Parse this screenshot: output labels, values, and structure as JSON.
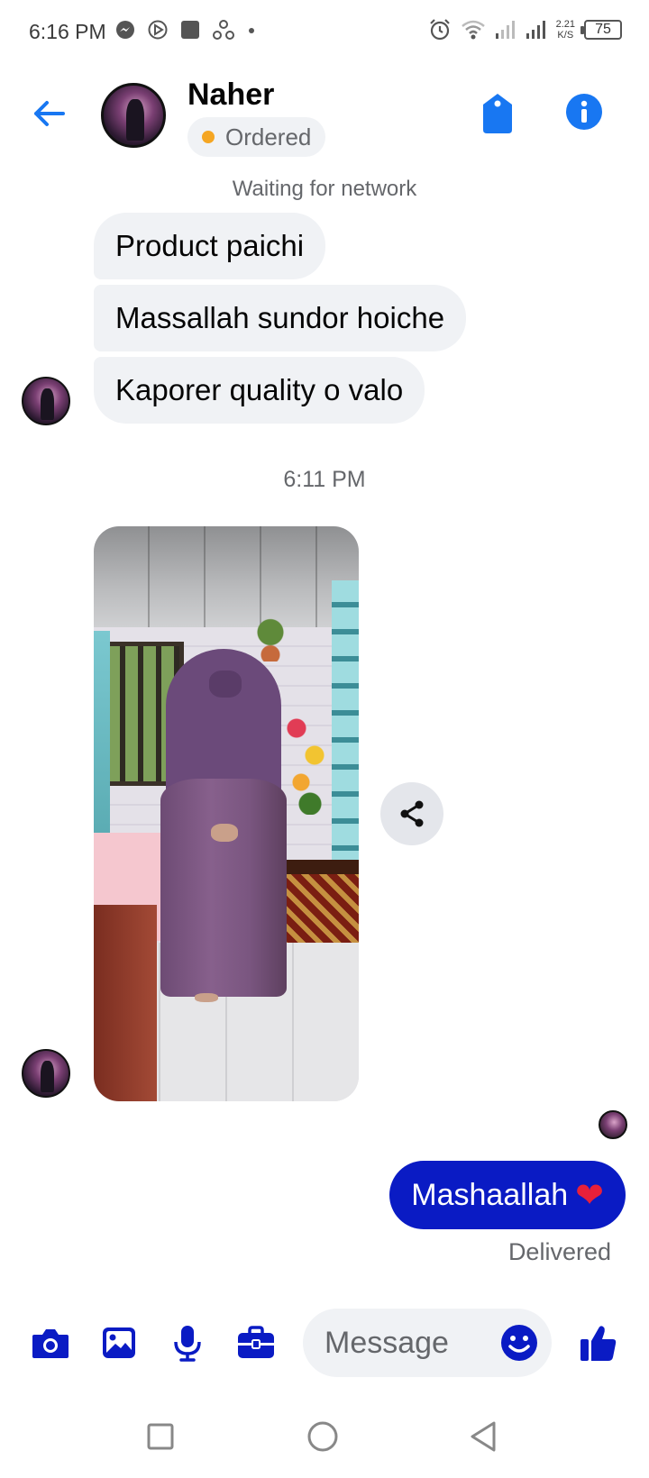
{
  "status_bar": {
    "time": "6:16 PM",
    "speed_value": "2.21",
    "speed_unit": "K/S",
    "battery": "75"
  },
  "header": {
    "contact_name": "Naher",
    "status_label": "Ordered",
    "status_color": "#f5a623",
    "accent_color": "#1877f2"
  },
  "network_status": "Waiting for network",
  "messages": {
    "incoming": [
      "Product paichi",
      "Massallah sundor hoiche",
      "Kaporer quality o valo"
    ],
    "timestamp": "6:11 PM",
    "outgoing_text": "Mashaallah",
    "outgoing_emoji": "❤",
    "outgoing_color": "#0a1bc4",
    "delivery_status": "Delivered"
  },
  "composer": {
    "placeholder": "Message",
    "icons": [
      "camera-icon",
      "gallery-icon",
      "microphone-icon",
      "briefcase-icon",
      "emoji-icon",
      "thumbs-up-icon"
    ],
    "icon_color": "#0a1bc4"
  }
}
